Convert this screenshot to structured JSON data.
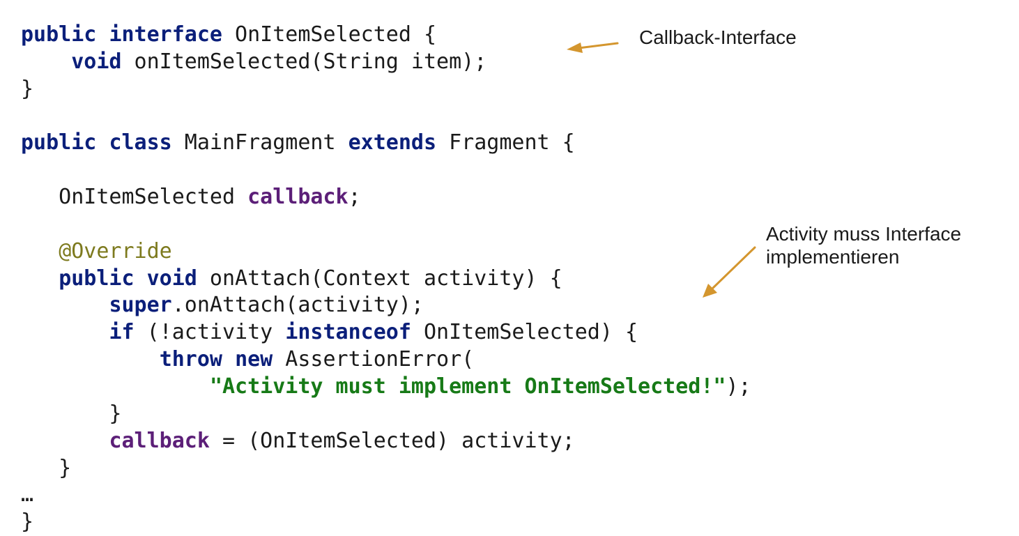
{
  "code": {
    "lines": [
      [
        {
          "t": "public",
          "c": "kw"
        },
        {
          "t": " "
        },
        {
          "t": "interface",
          "c": "kw"
        },
        {
          "t": " OnItemSelected {"
        }
      ],
      [
        {
          "t": "    "
        },
        {
          "t": "void",
          "c": "kw"
        },
        {
          "t": " onItemSelected(String item);"
        }
      ],
      [
        {
          "t": "}"
        }
      ],
      [],
      [
        {
          "t": "public",
          "c": "kw"
        },
        {
          "t": " "
        },
        {
          "t": "class",
          "c": "kw"
        },
        {
          "t": " MainFragment "
        },
        {
          "t": "extends",
          "c": "kw"
        },
        {
          "t": " Fragment {"
        }
      ],
      [],
      [
        {
          "t": "   OnItemSelected "
        },
        {
          "t": "callback",
          "c": "fld"
        },
        {
          "t": ";"
        }
      ],
      [],
      [
        {
          "t": "   "
        },
        {
          "t": "@Override",
          "c": "ann"
        }
      ],
      [
        {
          "t": "   "
        },
        {
          "t": "public",
          "c": "kw"
        },
        {
          "t": " "
        },
        {
          "t": "void",
          "c": "kw"
        },
        {
          "t": " onAttach(Context activity) {"
        }
      ],
      [
        {
          "t": "       "
        },
        {
          "t": "super",
          "c": "kw"
        },
        {
          "t": ".onAttach(activity);"
        }
      ],
      [
        {
          "t": "       "
        },
        {
          "t": "if",
          "c": "kw"
        },
        {
          "t": " (!activity "
        },
        {
          "t": "instanceof",
          "c": "kw"
        },
        {
          "t": " OnItemSelected) {"
        }
      ],
      [
        {
          "t": "           "
        },
        {
          "t": "throw",
          "c": "kw"
        },
        {
          "t": " "
        },
        {
          "t": "new",
          "c": "kw"
        },
        {
          "t": " AssertionError("
        }
      ],
      [
        {
          "t": "               "
        },
        {
          "t": "\"Activity must implement OnItemSelected!\"",
          "c": "str"
        },
        {
          "t": ");"
        }
      ],
      [
        {
          "t": "       }"
        }
      ],
      [
        {
          "t": "       "
        },
        {
          "t": "callback",
          "c": "fld"
        },
        {
          "t": " = (OnItemSelected) activity;"
        }
      ],
      [
        {
          "t": "   }"
        }
      ],
      [
        {
          "t": "…"
        }
      ],
      [
        {
          "t": "}"
        }
      ]
    ]
  },
  "annotations": {
    "callback_interface": "Callback-Interface",
    "activity_line1": "Activity muss Interface",
    "activity_line2": "implementieren"
  },
  "colors": {
    "keyword": "#0b1f7a",
    "field": "#5c1f78",
    "annotation": "#7d7a1e",
    "string": "#177a17",
    "arrow": "#d4962e"
  }
}
